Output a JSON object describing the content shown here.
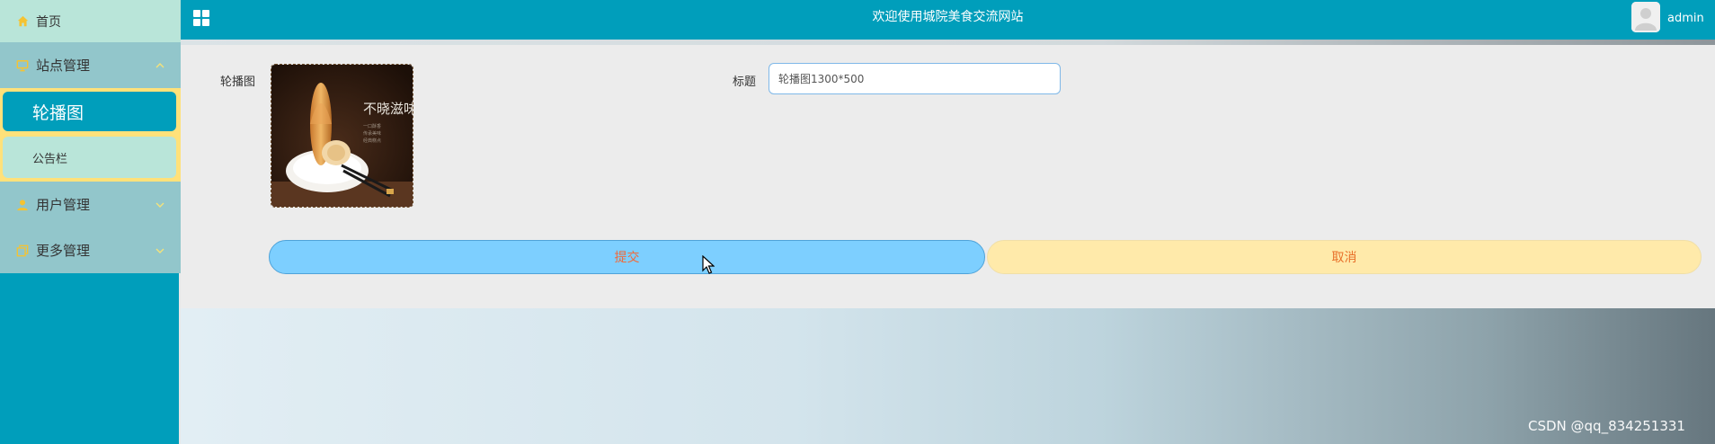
{
  "app": {
    "title": "欢迎使用城院美食交流网站",
    "user": "admin"
  },
  "sidebar": {
    "home_label": "首页",
    "groups": [
      {
        "label": "站点管理",
        "icon": "monitor-icon",
        "expanded": true
      },
      {
        "label": "用户管理",
        "icon": "user-icon",
        "expanded": false
      },
      {
        "label": "更多管理",
        "icon": "copy-icon",
        "expanded": false
      }
    ],
    "subitems": [
      {
        "label": "轮播图",
        "active": true
      },
      {
        "label": "公告栏",
        "active": false
      }
    ]
  },
  "form": {
    "image_label": "轮播图",
    "title_label": "标题",
    "title_value": "轮播图1300*500",
    "submit_label": "提交",
    "cancel_label": "取消"
  },
  "image_text": {
    "calligraphy": "不晓滋味",
    "small_lines": [
      "一口酥香",
      "传承美味",
      "经典糕点"
    ]
  },
  "watermark": "CSDN @qq_834251331",
  "colors": {
    "primary": "#009ebb",
    "sidebar_group": "#92c6cb",
    "sidebar_light": "#b9e5d9",
    "highlight": "#ffe17a",
    "submit_bg": "#7dcfff",
    "cancel_bg": "#ffeaaa",
    "button_text": "#f06a3a"
  }
}
